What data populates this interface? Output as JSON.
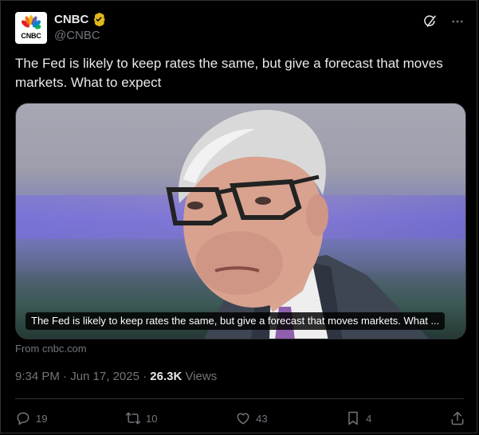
{
  "account": {
    "display_name": "CNBC",
    "handle": "@CNBC",
    "avatar_text": "CNBC"
  },
  "post": {
    "text": "The Fed is likely to keep rates the same, but give a forecast that moves markets. What to expect"
  },
  "card": {
    "caption": "The Fed is likely to keep rates the same, but give a forecast that moves markets. What ...",
    "source": "From cnbc.com"
  },
  "meta": {
    "timestamp": "9:34 PM · Jun 17, 2025 · ",
    "views_count": "26.3K",
    "views_label": " Views"
  },
  "actions": {
    "replies": "19",
    "reposts": "10",
    "likes": "43",
    "bookmarks": "4"
  },
  "icons": {
    "grok": "grok-icon",
    "more": "more-icon",
    "reply": "reply-icon",
    "repost": "repost-icon",
    "like": "like-icon",
    "bookmark": "bookmark-icon",
    "share": "share-icon",
    "verified": "verified-badge-icon"
  },
  "colors": {
    "background": "#000000",
    "text": "#e7e9ea",
    "muted": "#71767b",
    "verified_gold": "#e2b719"
  }
}
